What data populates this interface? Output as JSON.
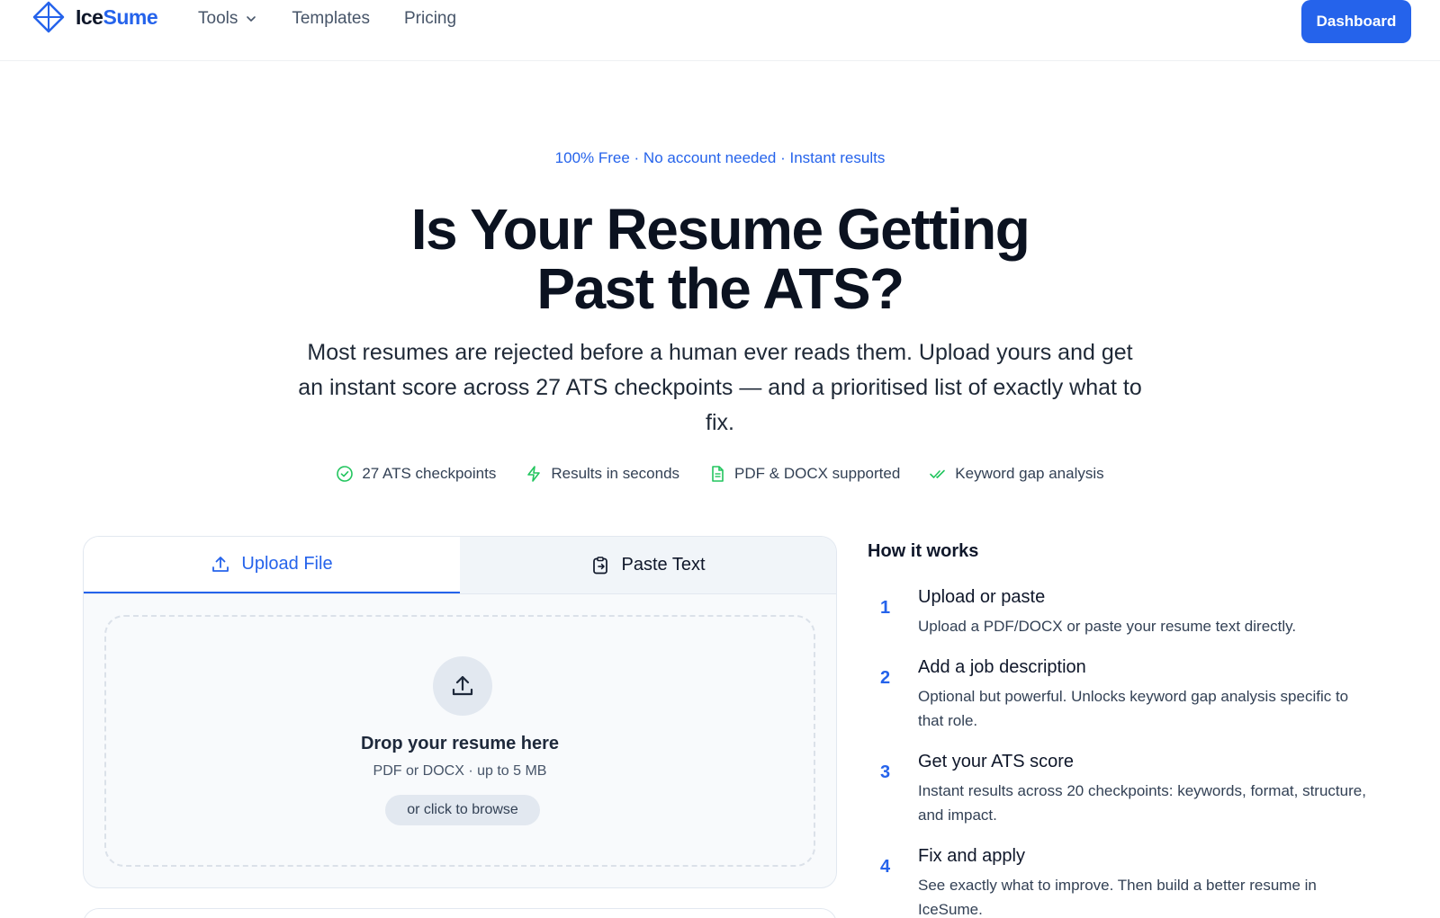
{
  "brand": {
    "name_part1": "Ice",
    "name_part2": "Sume",
    "accent_color": "#2563eb"
  },
  "nav": {
    "items": [
      {
        "label": "Tools",
        "has_dropdown": true
      },
      {
        "label": "Templates"
      },
      {
        "label": "Pricing"
      }
    ],
    "dashboard_label": "Dashboard"
  },
  "hero": {
    "eyebrow": "100% Free · No account needed · Instant results",
    "title_line1": "Is Your Resume Getting",
    "title_line2": "Past the ATS?",
    "subtitle": "Most resumes are rejected before a human ever reads them. Upload yours and get an instant score across 27 ATS checkpoints — and a prioritised list of exactly what to fix."
  },
  "features": [
    {
      "icon": "check-circle-icon",
      "label": "27 ATS checkpoints"
    },
    {
      "icon": "lightning-icon",
      "label": "Results in seconds"
    },
    {
      "icon": "document-icon",
      "label": "PDF & DOCX supported"
    },
    {
      "icon": "double-check-icon",
      "label": "Keyword gap analysis"
    }
  ],
  "upload": {
    "tabs": [
      {
        "label": "Upload File",
        "icon": "upload-icon",
        "active": true
      },
      {
        "label": "Paste Text",
        "icon": "clipboard-icon",
        "active": false
      }
    ],
    "drop_title": "Drop your resume here",
    "drop_sub": "PDF or DOCX · up to 5 MB",
    "browse_label": "or click to browse"
  },
  "how_it_works": {
    "title": "How it works",
    "steps": [
      {
        "num": "1",
        "title": "Upload or paste",
        "desc": "Upload a PDF/DOCX or paste your resume text directly."
      },
      {
        "num": "2",
        "title": "Add a job description",
        "desc": "Optional but powerful. Unlocks keyword gap analysis specific to that role."
      },
      {
        "num": "3",
        "title": "Get your ATS score",
        "desc": "Instant results across 20 checkpoints: keywords, format, structure, and impact."
      },
      {
        "num": "4",
        "title": "Fix and apply",
        "desc": "See exactly what to improve. Then build a better resume in IceSume."
      }
    ]
  }
}
